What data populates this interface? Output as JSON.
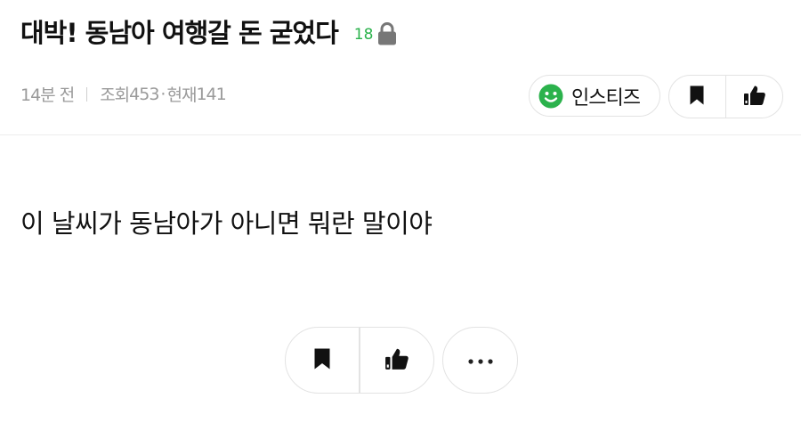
{
  "post": {
    "title": "대박! 동남아 여행갈 돈 굳었다",
    "comment_count": "18",
    "lock_icon": "lock-icon",
    "time_ago": "14분 전",
    "views_label": "조회",
    "views": "453",
    "current_label": "현재",
    "current": "141",
    "body": "이 날씨가 동남아가 아니면 뭐란 말이야"
  },
  "author": {
    "name": "인스티즈",
    "icon": "smile-icon",
    "icon_color": "#2bb24c"
  },
  "actions": {
    "bookmark_icon": "bookmark-icon",
    "like_icon": "thumbs-up-icon",
    "more_icon": "more-horizontal-icon"
  },
  "colors": {
    "accent_green": "#2bb24c",
    "meta_gray": "#9a9a9a",
    "border_gray": "#e3e3e3"
  }
}
